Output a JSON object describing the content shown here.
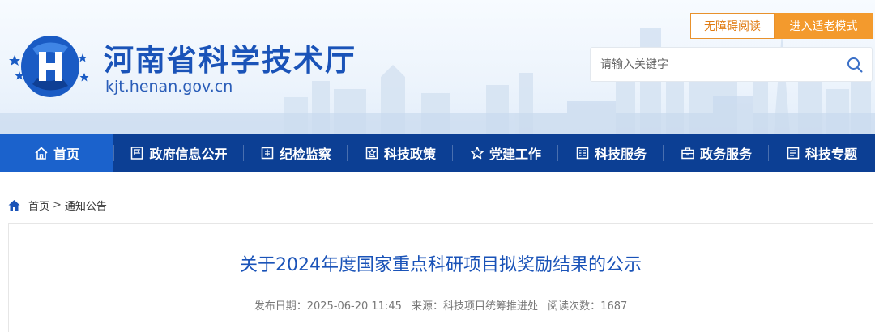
{
  "site": {
    "title": "河南省科学技术厅",
    "domain": "kjt.henan.gov.cn"
  },
  "topbar": {
    "accessible_label": "无障碍阅读",
    "elder_mode_label": "进入适老模式"
  },
  "search": {
    "placeholder": "请输入关键字"
  },
  "nav": {
    "items": [
      {
        "label": "首页",
        "icon": "home-icon",
        "active": true
      },
      {
        "label": "政府信息公开",
        "icon": "document-flag-icon"
      },
      {
        "label": "纪检监察",
        "icon": "monitor-icon"
      },
      {
        "label": "科技政策",
        "icon": "policy-icon"
      },
      {
        "label": "党建工作",
        "icon": "star-icon"
      },
      {
        "label": "科技服务",
        "icon": "grid-list-icon"
      },
      {
        "label": "政务服务",
        "icon": "briefcase-icon"
      },
      {
        "label": "科技专题",
        "icon": "list-icon"
      }
    ]
  },
  "breadcrumb": {
    "home": "首页",
    "separator": ">",
    "current": "通知公告"
  },
  "article": {
    "title": "关于2024年度国家重点科研项目拟奖励结果的公示",
    "publish_date": "发布日期：2025-06-20 11:45",
    "source": "来源：科技项目统筹推进处",
    "views": "阅读次数：1687"
  },
  "colors": {
    "nav_bg": "#0c3f94",
    "nav_active": "#1b62cc",
    "brand_blue": "#1a53b8",
    "accent_orange": "#f39a2d"
  }
}
